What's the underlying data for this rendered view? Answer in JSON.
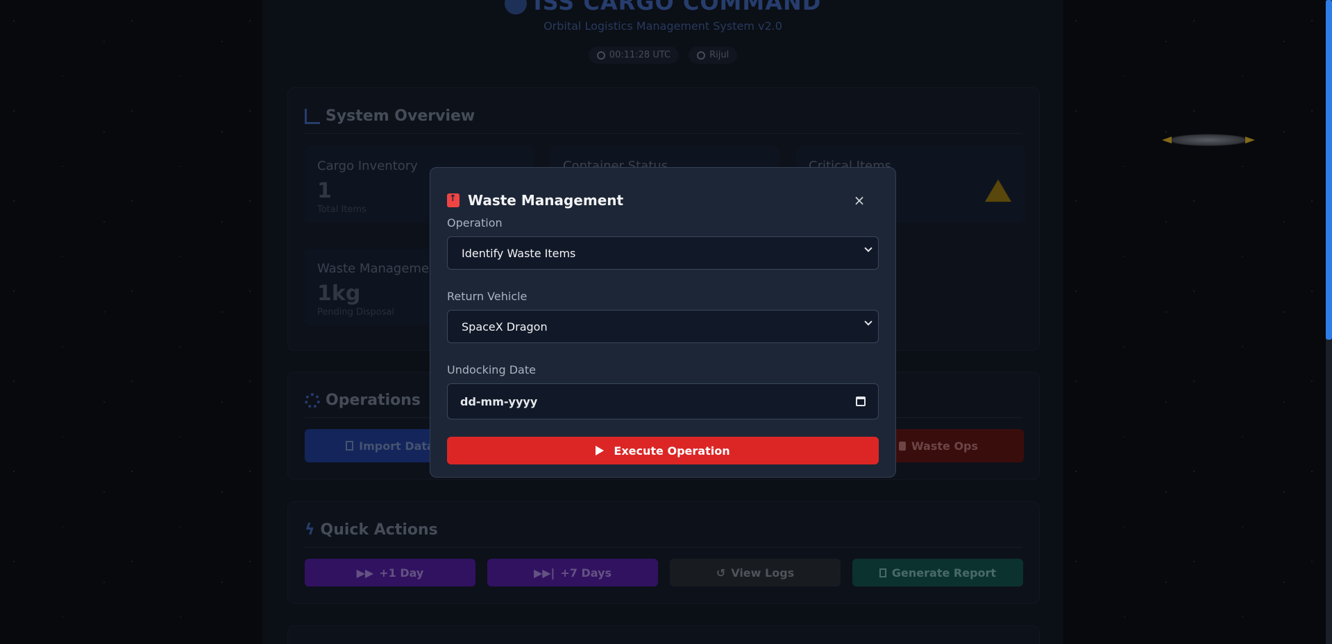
{
  "app": {
    "title": "ISS CARGO COMMAND",
    "subtitle": "Orbital Logistics Management System v2.0",
    "time": "00:11:28 UTC",
    "user": "Rijul"
  },
  "overview": {
    "title": "System Overview",
    "cards": [
      {
        "label": "Cargo Inventory",
        "value": "1",
        "sub": "Total Items"
      },
      {
        "label": "Container Status",
        "value": "",
        "sub": ""
      },
      {
        "label": "Critical Items",
        "value": "",
        "sub": ""
      },
      {
        "label": "Waste Management",
        "value": "1kg",
        "sub": "Pending Disposal"
      }
    ]
  },
  "operations": {
    "title": "Operations",
    "buttons": {
      "import": "Import Data",
      "waste": "Waste Ops"
    }
  },
  "quick_actions": {
    "title": "Quick Actions",
    "buttons": [
      "+1 Day",
      "+7 Days",
      "View Logs",
      "Generate Report"
    ]
  },
  "modal": {
    "title": "Waste Management",
    "close": "×",
    "operation_label": "Operation",
    "operation_value": "Identify Waste Items",
    "vehicle_label": "Return Vehicle",
    "vehicle_value": "SpaceX Dragon",
    "date_label": "Undocking Date",
    "date_placeholder": "dd-mm-yyyy",
    "execute": "Execute Operation"
  },
  "colors": {
    "accent_red": "#dc2626",
    "import_blue": "#1e3a8a",
    "purple": "#4c1d95",
    "teal": "#134e4a"
  }
}
